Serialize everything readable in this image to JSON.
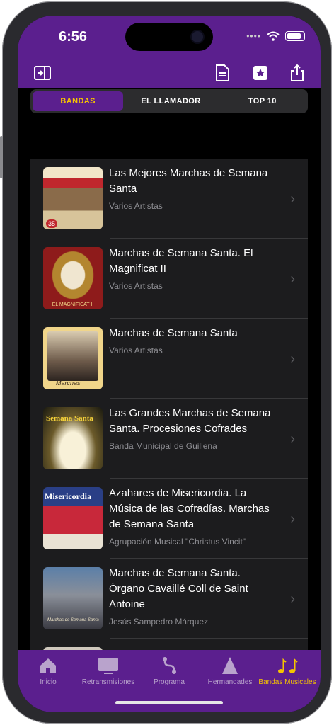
{
  "status": {
    "time": "6:56"
  },
  "segments": [
    "BANDAS",
    "EL LLAMADOR",
    "TOP 10"
  ],
  "albums": [
    {
      "title": "Las Mejores Marchas de Semana Santa",
      "artist": "Varios Artistas",
      "art": "35"
    },
    {
      "title": "Marchas de Semana Santa. El Magnificat II",
      "artist": "Varios Artistas",
      "art": "EL MAGNIFICAT II"
    },
    {
      "title": "Marchas de Semana Santa",
      "artist": "Varios Artistas",
      "art": "Marchas"
    },
    {
      "title": "Las Grandes Marchas de Semana Santa. Procesiones Cofrades",
      "artist": "Banda Municipal de Guillena",
      "art": "Semana Santa"
    },
    {
      "title": "Azahares de Misericordia. La Música de las Cofradías. Marchas de Semana Santa",
      "artist": "Agrupación Musical \"Christus Vincit\"",
      "art": "Misericordia"
    },
    {
      "title": "Marchas de Semana Santa. Órgano Cavaillé Coll de Saint Antoine",
      "artist": "Jesús Sampedro Márquez",
      "art": "Marchas de Semana Santa"
    }
  ],
  "tabs": [
    "Inicio",
    "Retransmisiones",
    "Programa",
    "Hermandades",
    "Bandas Musicales"
  ],
  "colors": {
    "brand": "#5b1f8e",
    "accent": "#f5c400"
  }
}
